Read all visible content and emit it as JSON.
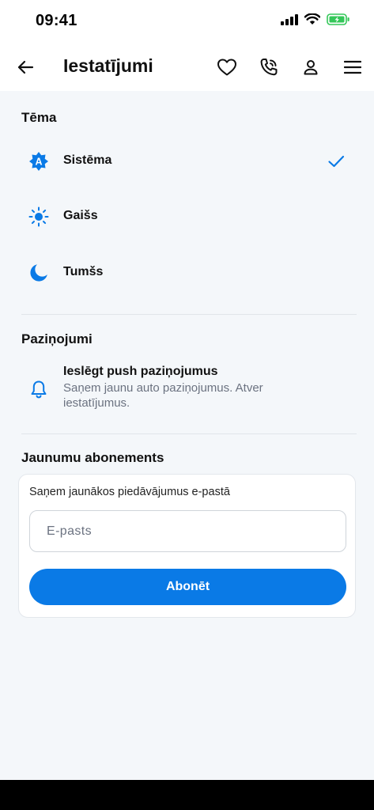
{
  "status_bar": {
    "time": "09:41"
  },
  "header": {
    "title": "Iestatījumi"
  },
  "theme": {
    "title": "Tēma",
    "options": [
      {
        "label": "Sistēma",
        "icon": "auto-theme-icon",
        "selected": true
      },
      {
        "label": "Gaišs",
        "icon": "sun-icon",
        "selected": false
      },
      {
        "label": "Tumšs",
        "icon": "moon-icon",
        "selected": false
      }
    ]
  },
  "notifications": {
    "title": "Paziņojumi",
    "item_title": "Ieslēgt push paziņojumus",
    "item_desc": "Saņem jaunu auto paziņojumus. Atver iestatījumus."
  },
  "newsletter": {
    "title": "Jaunumu abonements",
    "card_label": "Saņem jaunākos piedāvājumus e-pastā",
    "email_placeholder": "E-pasts",
    "email_value": "",
    "subscribe_label": "Abonēt"
  },
  "colors": {
    "accent": "#0a7ae6",
    "background": "#f4f7fa",
    "battery": "#34c759"
  }
}
